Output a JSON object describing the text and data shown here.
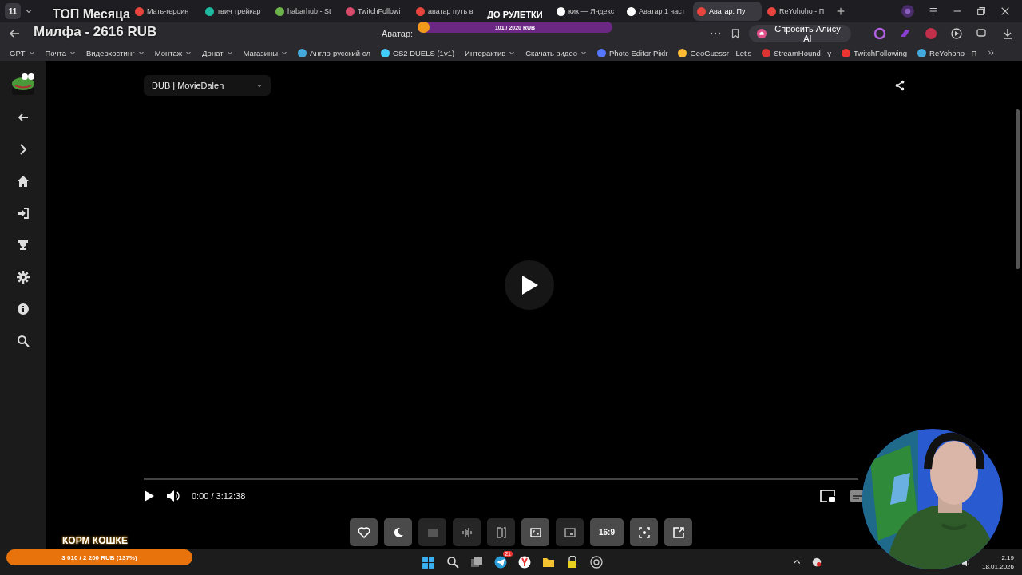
{
  "tab_counter": "11",
  "tabs": [
    {
      "selected": false
    },
    {
      "label": "Мать-героин",
      "selected": false
    },
    {
      "label": "твич трейкар",
      "selected": false
    },
    {
      "label": "habarhub - St",
      "selected": false
    },
    {
      "label": "TwitchFollowi",
      "selected": false
    },
    {
      "label": "аватар путь в",
      "selected": false
    },
    {
      "selected": false
    },
    {
      "label": "кик — Яндекс",
      "selected": false
    },
    {
      "label": "Аватар 1 част",
      "selected": false
    },
    {
      "label": "Аватар: Пу",
      "selected": true
    },
    {
      "label": "ReYohoho - П",
      "selected": false
    }
  ],
  "address_bar": {
    "page_title": "Аватар:",
    "assistant_button": "Спросить Алису AI"
  },
  "bookmarks": [
    {
      "label": "GPT",
      "dropdown": true
    },
    {
      "label": "Почта",
      "dropdown": true
    },
    {
      "label": "Видеохостинг",
      "dropdown": true
    },
    {
      "label": "Монтаж",
      "dropdown": true
    },
    {
      "label": "Донат",
      "dropdown": true
    },
    {
      "label": "Магазины",
      "dropdown": true
    },
    {
      "label": "Англо-русский сл",
      "dropdown": false
    },
    {
      "label": "CS2 DUELS (1v1)",
      "dropdown": false
    },
    {
      "label": "Интерактив",
      "dropdown": true
    },
    {
      "label": "Скачать видео",
      "dropdown": true
    },
    {
      "label": "Photo Editor Pixlr",
      "dropdown": false
    },
    {
      "label": "GeoGuessr - Let's",
      "dropdown": false
    },
    {
      "label": "StreamHound - y",
      "dropdown": false
    },
    {
      "label": "TwitchFollowing",
      "dropdown": false
    },
    {
      "label": "ReYohoho - П",
      "dropdown": false
    }
  ],
  "player": {
    "voice_select": "DUB | MovieDalen",
    "progress": {
      "level": 0
    },
    "time": "0:00 / 3:12:38",
    "toolbar": [
      {
        "on": true
      },
      {
        "on": true
      },
      {
        "on": false
      },
      {
        "on": false
      },
      {
        "on": false
      },
      {
        "on": true
      },
      {
        "on": false
      },
      {
        "label": "16:9",
        "on": true
      },
      {
        "on": true
      },
      {
        "on": true
      }
    ]
  },
  "overlays": {
    "top_month_title": "ТОП Месяца",
    "top_month_value": "Милфа - 2616 RUB",
    "roulette": {
      "title": "ДО РУЛЕТКИ",
      "value": "101 / 2020 RUB",
      "level": 0.05
    },
    "cat_food": {
      "title": "КОРМ КОШКЕ",
      "value": "3 010 / 2 200 RUB (137%)",
      "level": 1
    }
  },
  "taskbar": {
    "telegram_badge": "21",
    "time": "2:19",
    "date": "18.01.2026"
  }
}
